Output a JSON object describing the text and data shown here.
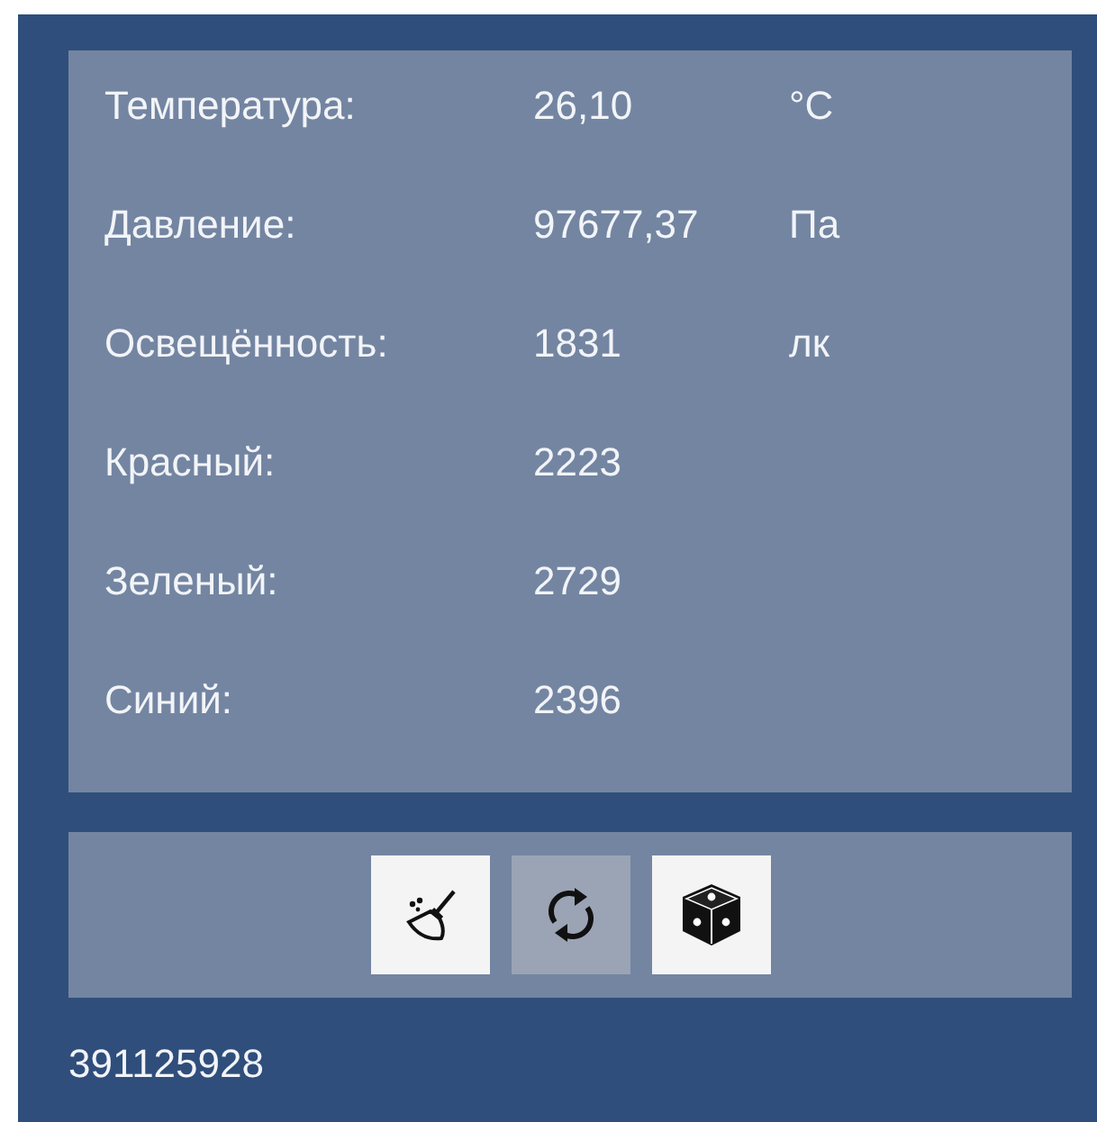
{
  "readings": [
    {
      "label": "Температура:",
      "value": "26,10",
      "unit": "°C"
    },
    {
      "label": "Давление:",
      "value": "97677,37",
      "unit": "Па"
    },
    {
      "label": "Освещённость:",
      "value": "1831",
      "unit": "лк"
    },
    {
      "label": "Красный:",
      "value": "2223"
    },
    {
      "label": "Зеленый:",
      "value": "2729"
    },
    {
      "label": "Синий:",
      "value": "2396"
    }
  ],
  "buttons": [
    {
      "kind": "clear",
      "active": false
    },
    {
      "kind": "refresh",
      "active": true
    },
    {
      "kind": "random",
      "active": false
    }
  ],
  "footer": "391125928"
}
